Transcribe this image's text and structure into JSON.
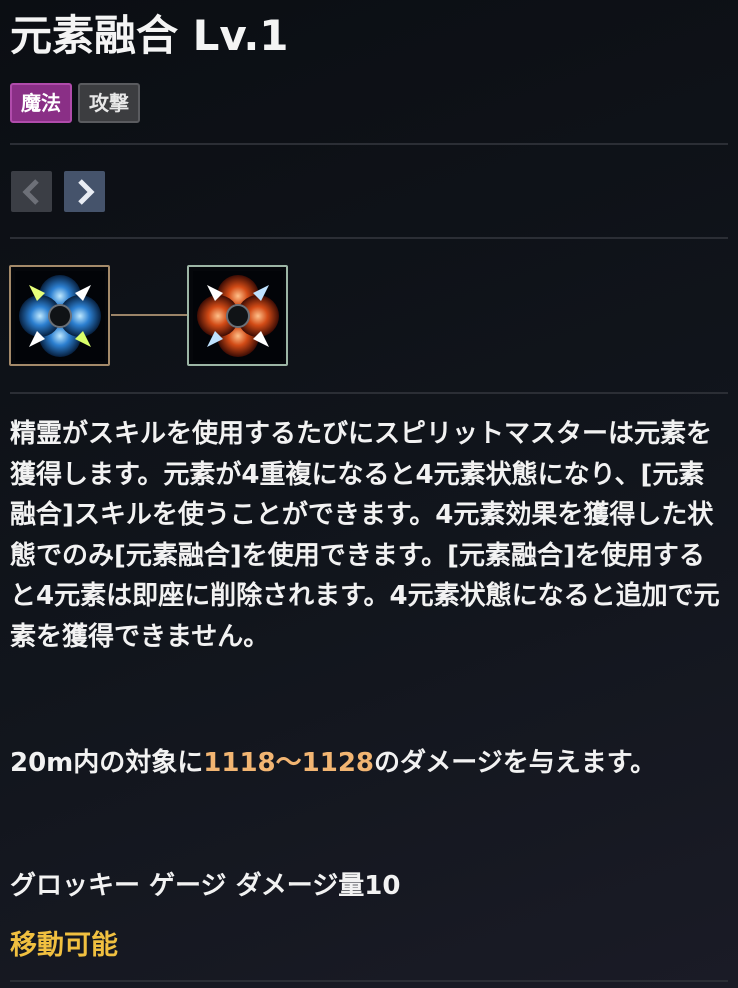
{
  "skill": {
    "title": "元素融合 Lv.1",
    "tags": [
      "魔法",
      "攻撃"
    ]
  },
  "nav": {
    "prev_icon": "chevron-left-icon",
    "next_icon": "chevron-right-icon"
  },
  "skill_tree": {
    "nodes": [
      {
        "icon": "element-fusion-blue-icon",
        "border_color": "#a48a6a"
      },
      {
        "icon": "element-fusion-red-icon",
        "border_color": "#9cb5a5"
      }
    ]
  },
  "description": {
    "body": "精霊がスキルを使用するたびにスピリットマスターは元素を獲得します。元素が4重複になると4元素状態になり、[元素融合]スキルを使うことができます。4元素効果を獲得した状態でのみ[元素融合]を使用できます。[元素融合]を使用すると4元素は即座に削除されます。4元素状態になると追加で元素を獲得できません。",
    "damage_prefix": "20m内の対象に",
    "damage_value": "1118〜1128",
    "damage_suffix": "のダメージを与えます。",
    "groggy": "グロッキー ゲージ ダメージ量10",
    "movable": "移動可能"
  },
  "colors": {
    "highlight": "#f2b572",
    "movable": "#f1c040",
    "magic_tag": "#8a2f86"
  }
}
